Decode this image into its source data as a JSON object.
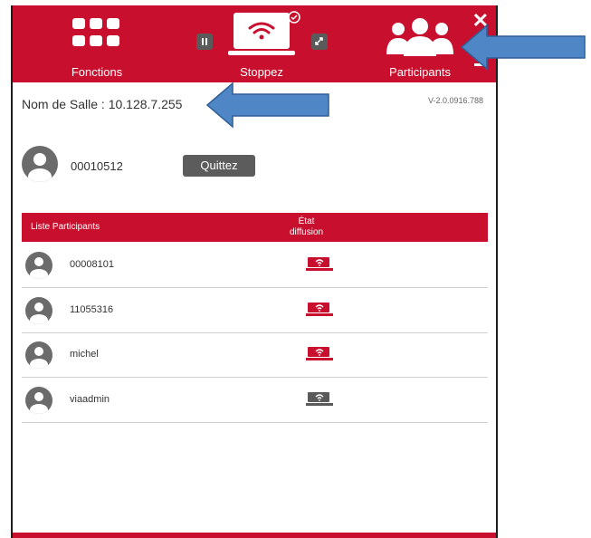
{
  "topbar": {
    "functions_label": "Fonctions",
    "stop_label": "Stoppez",
    "participants_label": "Participants"
  },
  "room": {
    "label": "Nom de Salle : 10.128.7.255"
  },
  "version": "V-2.0.0916.788",
  "self": {
    "id": "00010512",
    "quit_label": "Quittez"
  },
  "table": {
    "col_participants": "Liste Participants",
    "col_state_line1": "État",
    "col_state_line2": "diffusion",
    "rows": [
      {
        "name": "00008101",
        "status": "broadcasting",
        "color": "#c8102e"
      },
      {
        "name": "11055316",
        "status": "broadcasting",
        "color": "#c8102e"
      },
      {
        "name": "michel",
        "status": "broadcasting",
        "color": "#c8102e"
      },
      {
        "name": "viaadmin",
        "status": "idle",
        "color": "#5a5a5a"
      }
    ]
  },
  "colors": {
    "brand": "#c8102e",
    "button_gray": "#5c5c5c",
    "arrow_blue": "#4f86c6"
  }
}
